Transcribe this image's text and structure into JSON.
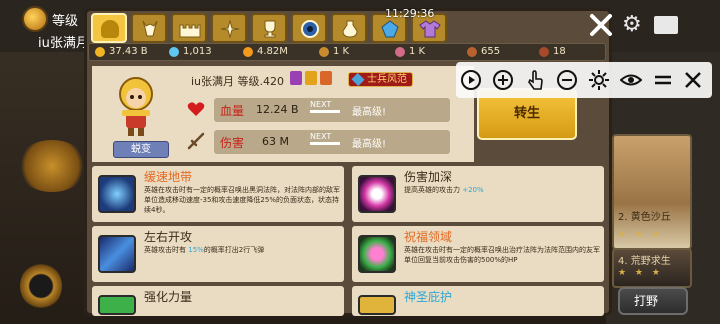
{
  "clock": "11:29:36",
  "background": {
    "level_label": "等级",
    "player_name": "iu张满月",
    "card1_label": "2. 黄色沙丘",
    "card2_label": "4. 荒野求生",
    "farm_button": "打野"
  },
  "tabs": [
    {
      "name": "hero-tab",
      "active": true
    },
    {
      "name": "deer-tab"
    },
    {
      "name": "castle-tab"
    },
    {
      "name": "sparkle-tab"
    },
    {
      "name": "trophy-tab"
    },
    {
      "name": "orb-tab"
    },
    {
      "name": "potion-tab"
    },
    {
      "name": "gem-tab"
    },
    {
      "name": "shirt-tab"
    }
  ],
  "resources": [
    {
      "name": "gold",
      "value": "37.43 B",
      "color": "#f0b626"
    },
    {
      "name": "diamond",
      "value": "1,013",
      "color": "#5fc6ef"
    },
    {
      "name": "coin",
      "value": "4.82M",
      "color": "#f29a1c"
    },
    {
      "name": "horn",
      "value": "1 K",
      "color": "#c98b2e"
    },
    {
      "name": "cloak",
      "value": "1 K",
      "color": "#d36b8a"
    },
    {
      "name": "meat",
      "value": "655",
      "color": "#b9622f"
    },
    {
      "name": "chest",
      "value": "18",
      "color": "#a64a2a"
    }
  ],
  "hero": {
    "name_level": "iu张满月  等级.420",
    "rank": "士兵风范",
    "morph_button": "蜕变",
    "upgrade_button": "转生",
    "hp_label": "血量",
    "hp_value": "12.24 B",
    "dmg_label": "伤害",
    "dmg_value": "63 M",
    "next_label": "NEXT",
    "max_label": "最高级!"
  },
  "skills": [
    {
      "title": "缓速地带",
      "title_color": "#e36a23",
      "desc": "英雄在攻击时有一定的概率召唤出黑洞法阵，对法阵内部的敌军单位造成移动速度-35和攻击速度降低25%的负面状态，状态持续4秒。",
      "highlight": ""
    },
    {
      "title": "伤害加深",
      "title_color": "#3a2c1a",
      "desc": "提高英雄的攻击力 ",
      "highlight": "+20%"
    },
    {
      "title": "左右开攻",
      "title_color": "#3a2c1a",
      "desc": "英雄攻击时有 ",
      "highlight": "15%",
      "desc_tail": "的概率打出2行飞弹"
    },
    {
      "title": "祝福领域",
      "title_color": "#e36a23",
      "desc": "英雄在攻击时有一定的概率召唤出治疗法阵为法阵范围内的友军单位回复当前攻击伤害的500%的HP",
      "highlight": ""
    },
    {
      "title": "强化力量",
      "title_color": "#3a2c1a",
      "desc": "",
      "highlight": ""
    },
    {
      "title": "神圣庇护",
      "title_color": "#2da8d6",
      "desc": "",
      "highlight": ""
    }
  ]
}
